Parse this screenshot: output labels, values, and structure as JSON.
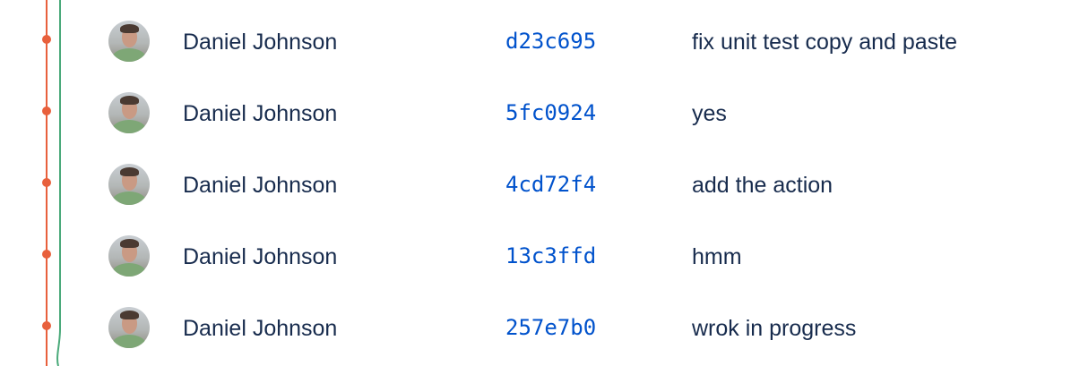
{
  "graph": {
    "branch_color": "#e8603c",
    "secondary_branch_color": "#4aaa7a"
  },
  "commits": [
    {
      "author": "Daniel Johnson",
      "hash": "d23c695",
      "message": "fix unit test copy and paste",
      "avatar_icon": "user-avatar-icon"
    },
    {
      "author": "Daniel Johnson",
      "hash": "5fc0924",
      "message": "yes",
      "avatar_icon": "user-avatar-icon"
    },
    {
      "author": "Daniel Johnson",
      "hash": "4cd72f4",
      "message": "add the action",
      "avatar_icon": "user-avatar-icon"
    },
    {
      "author": "Daniel Johnson",
      "hash": "13c3ffd",
      "message": "hmm",
      "avatar_icon": "user-avatar-icon"
    },
    {
      "author": "Daniel Johnson",
      "hash": "257e7b0",
      "message": "wrok in progress",
      "avatar_icon": "user-avatar-icon"
    }
  ]
}
